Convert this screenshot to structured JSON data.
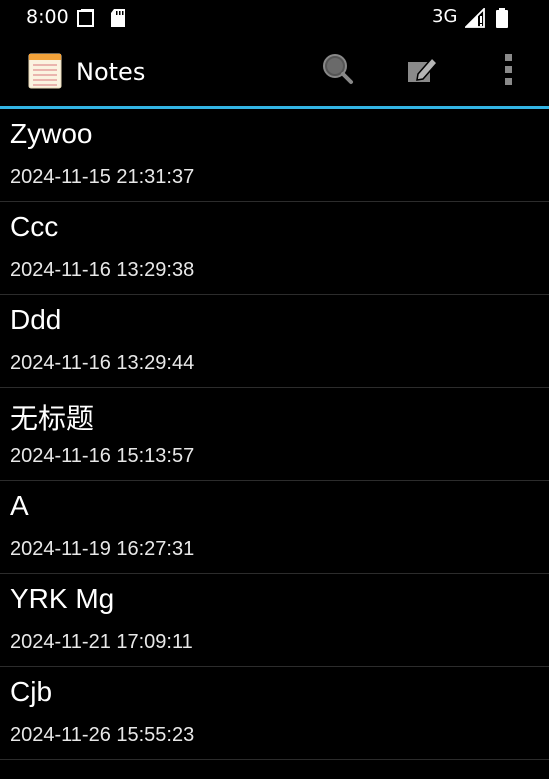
{
  "status_bar": {
    "time": "8:00",
    "network": "3G"
  },
  "action_bar": {
    "title": "Notes",
    "icons": [
      "notepad-icon",
      "search-icon",
      "compose-icon",
      "overflow-menu-icon"
    ]
  },
  "colors": {
    "background": "#000000",
    "accent": "#33b5e5"
  },
  "notes": [
    {
      "title": "Zywoo",
      "date": "2024-11-15 21:31:37"
    },
    {
      "title": "Ccc",
      "date": "2024-11-16 13:29:38"
    },
    {
      "title": "Ddd",
      "date": "2024-11-16 13:29:44"
    },
    {
      "title": "无标题",
      "date": "2024-11-16 15:13:57"
    },
    {
      "title": "A",
      "date": "2024-11-19 16:27:31"
    },
    {
      "title": "YRK Mg",
      "date": "2024-11-21 17:09:11"
    },
    {
      "title": "Cjb",
      "date": "2024-11-26 15:55:23"
    }
  ]
}
